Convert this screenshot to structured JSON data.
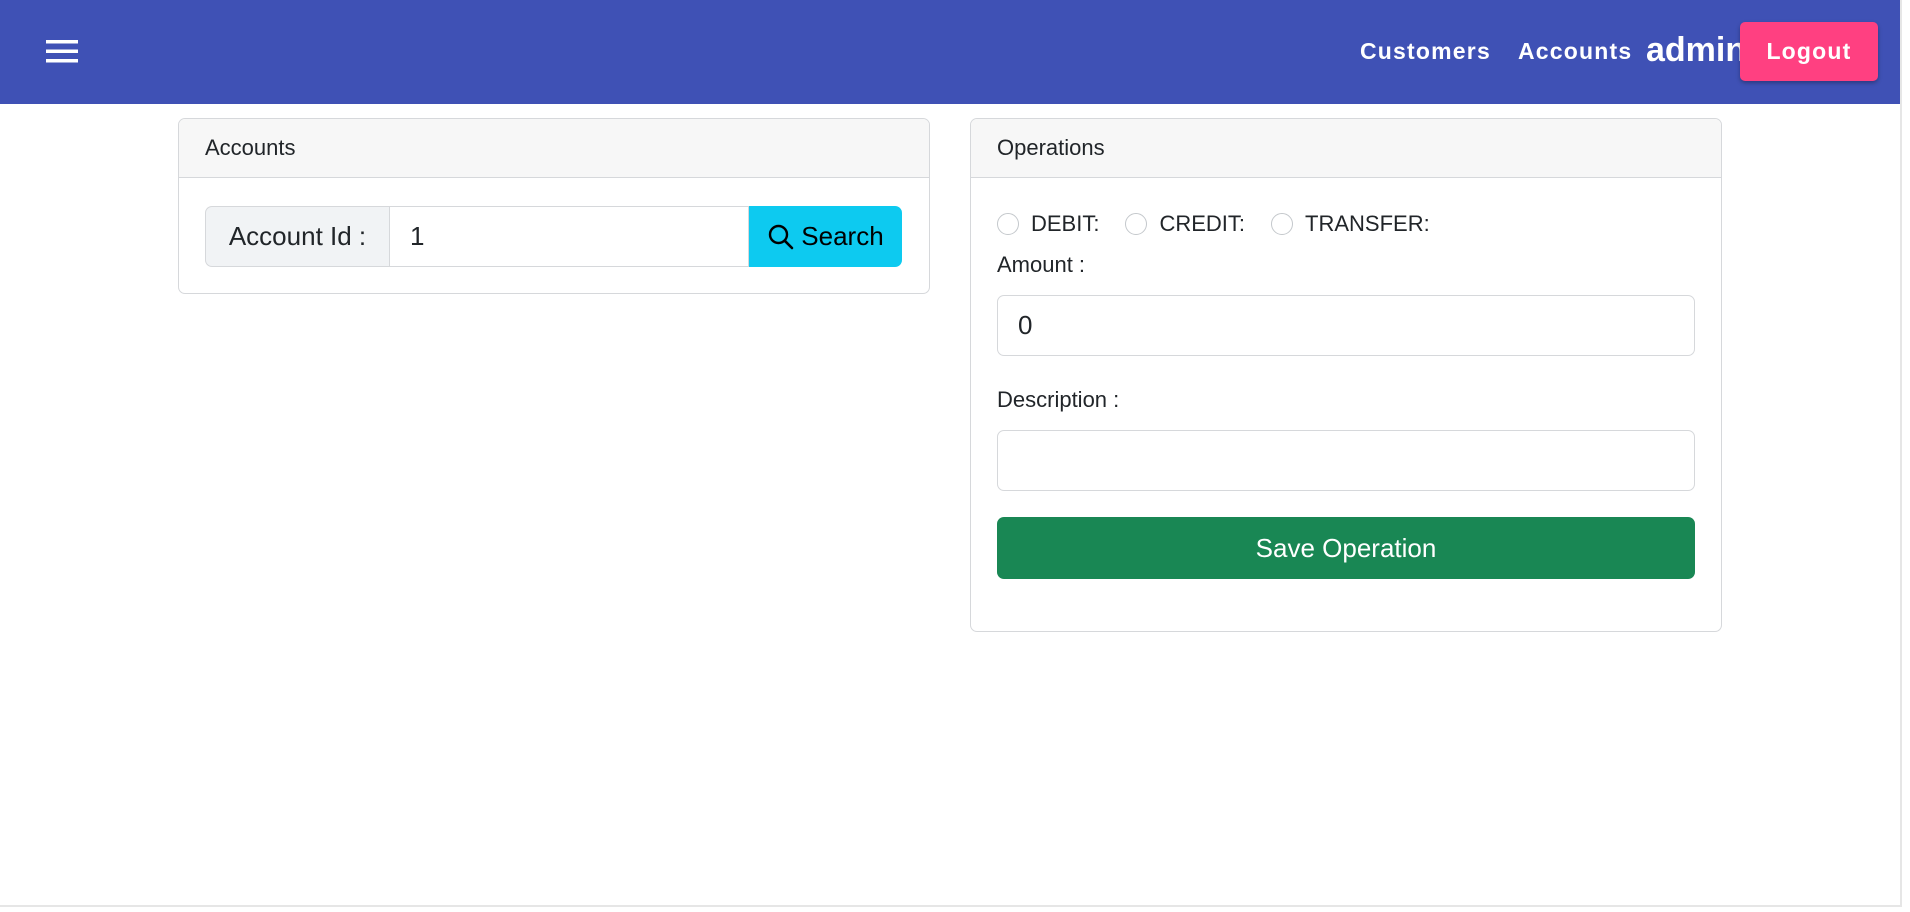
{
  "toolbar": {
    "menu_icon": "hamburger-menu-icon",
    "nav": {
      "customers": "Customers",
      "accounts": "Accounts"
    },
    "username": "admin",
    "logout_label": "Logout",
    "colors": {
      "toolbar_bg": "#3f51b5",
      "logout_bg": "#ff4081"
    }
  },
  "accounts_card": {
    "header": "Accounts",
    "account_id_label": "Account Id :",
    "account_id_value": "1",
    "search_icon": "search-icon",
    "search_label": "Search",
    "colors": {
      "search_bg": "#0dcaf0"
    }
  },
  "operations_card": {
    "header": "Operations",
    "operation_types": [
      {
        "label": "DEBIT:",
        "checked": false
      },
      {
        "label": "CREDIT:",
        "checked": false
      },
      {
        "label": "TRANSFER:",
        "checked": false
      }
    ],
    "amount_label": "Amount :",
    "amount_value": "0",
    "description_label": "Description :",
    "description_value": "",
    "save_label": "Save Operation",
    "colors": {
      "save_bg": "#198754"
    }
  }
}
